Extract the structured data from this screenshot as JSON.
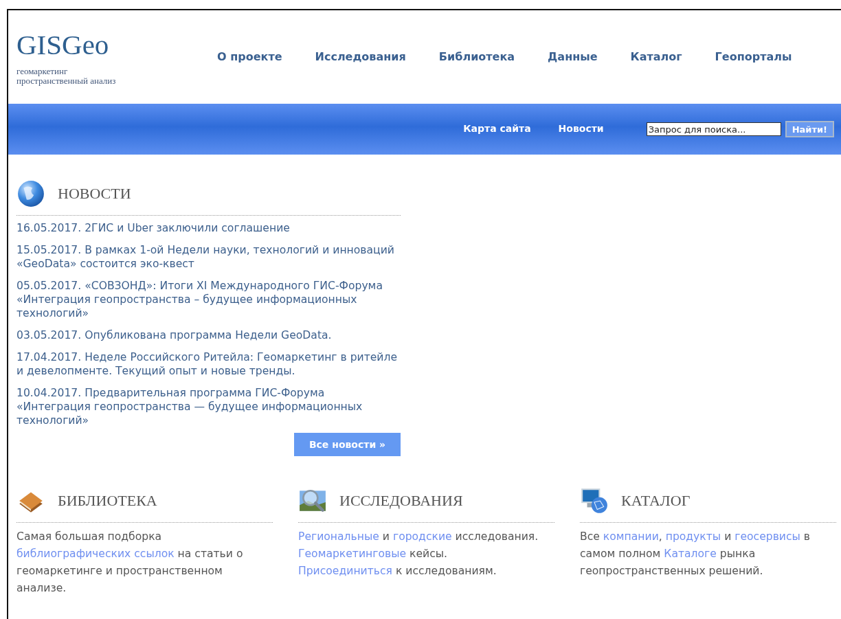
{
  "logo": {
    "title": "GISGeo",
    "tagline": [
      "геомаркетинг",
      "пространственный анализ"
    ]
  },
  "main_nav": [
    "О проекте",
    "Исследования",
    "Библиотека",
    "Данные",
    "Каталог",
    "Геопорталы"
  ],
  "sub_nav": [
    "Карта сайта",
    "Новости"
  ],
  "search": {
    "placeholder": "Запрос для поиска...",
    "button": "Найти!"
  },
  "news": {
    "title": "НОВОСТИ",
    "items": [
      {
        "date": "16.05.2017.",
        "title": "2ГИС и Uber заключили соглашение"
      },
      {
        "date": "15.05.2017.",
        "title": "В рамках 1-ой Недели науки, технологий и инноваций «GeoData» состоится эко-квест"
      },
      {
        "date": "05.05.2017.",
        "title": "«СОВЗОНД»: Итоги XI Международного ГИС-Форума «Интеграция геопространства – будущее информационных технологий»"
      },
      {
        "date": "03.05.2017.",
        "title": "Опубликована программа Недели GeoData."
      },
      {
        "date": "17.04.2017.",
        "title": "Неделе Российского Ритейла: Геомаркетинг в ритейле и девелопменте. Текущий опыт и новые тренды."
      },
      {
        "date": "10.04.2017.",
        "title": "Предварительная программа ГИС-Форума «Интеграция геопространства — будущее информационных технологий»"
      }
    ],
    "all_button": "Все новости »"
  },
  "sections": [
    {
      "kind": "books",
      "title": "БИБЛИОТЕКА",
      "text": [
        {
          "text": "Самая большая подборка ",
          "link": false
        },
        {
          "text": "библиографических ссылок",
          "link": true
        },
        {
          "text": " на статьи о геомаркетинге и пространственном анализе.",
          "link": false
        }
      ]
    },
    {
      "kind": "search",
      "title": "ИССЛЕДОВАНИЯ",
      "text": [
        {
          "text": "Региональные",
          "link": true
        },
        {
          "text": " и ",
          "link": false
        },
        {
          "text": "городские",
          "link": true
        },
        {
          "text": " исследования. ",
          "link": false
        },
        {
          "text": "Геомаркетинговые",
          "link": true
        },
        {
          "text": " кейсы. ",
          "link": false
        },
        {
          "text": "Присоединиться",
          "link": true
        },
        {
          "text": " к исследованиям.",
          "link": false
        }
      ]
    },
    {
      "kind": "network",
      "title": "КАТАЛОГ",
      "text": [
        {
          "text": "Все ",
          "link": false
        },
        {
          "text": "компании",
          "link": true
        },
        {
          "text": ", ",
          "link": false
        },
        {
          "text": "продукты",
          "link": true
        },
        {
          "text": " и ",
          "link": false
        },
        {
          "text": "геосервисы",
          "link": true
        },
        {
          "text": " в самом полном ",
          "link": false
        },
        {
          "text": "Каталоге",
          "link": true
        },
        {
          "text": " рынка геопространственных решений.",
          "link": false
        }
      ]
    }
  ]
}
